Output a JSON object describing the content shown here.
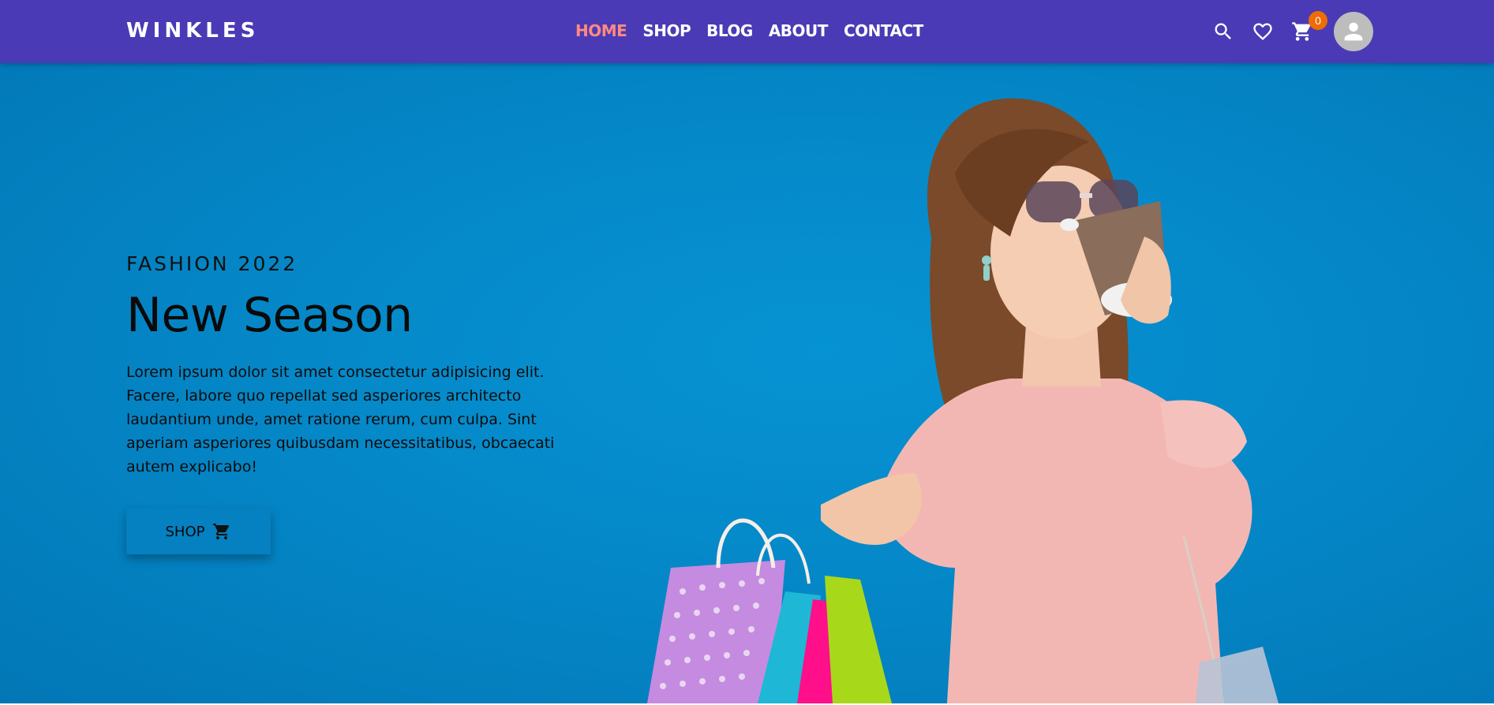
{
  "brand": {
    "name": "WINKLES"
  },
  "nav": {
    "links": [
      {
        "label": "HOME",
        "active": true
      },
      {
        "label": "SHOP"
      },
      {
        "label": "BLOG"
      },
      {
        "label": "ABOUT"
      },
      {
        "label": "CONTACT"
      }
    ]
  },
  "icons": {
    "search": "search-icon",
    "wishlist": "heart-icon",
    "cart": "cart-icon",
    "cart_count": "0",
    "avatar": "user-avatar-icon"
  },
  "hero": {
    "eyebrow": "FASHION 2022",
    "title": "New Season",
    "text": "Lorem ipsum dolor sit amet consectetur adipisicing elit. Facere, labore quo repellat sed asperiores architecto laudantium unde, amet ratione rerum, cum culpa. Sint aperiam asperiores quibusdam necessitatibus, obcaecati autem explicabo!",
    "button_label": "SHOP"
  },
  "colors": {
    "nav_bg": "#4a3ab5",
    "nav_active": "#ff8a80",
    "hero_bg": "#0588c8",
    "badge": "#ef6c00"
  }
}
